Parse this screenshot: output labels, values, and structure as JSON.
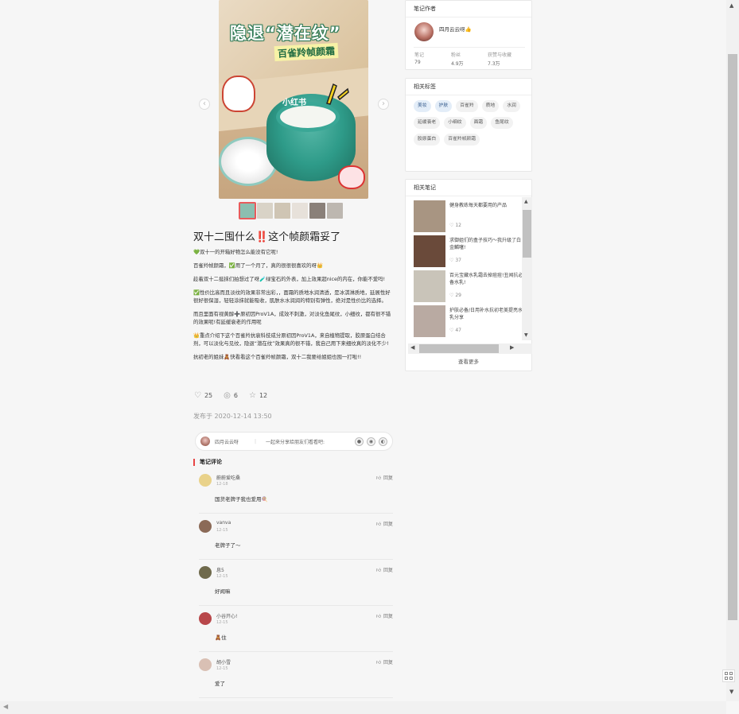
{
  "note": {
    "cover": {
      "title_text": "隐退“潜在纹”",
      "subtitle_text": "百雀羚帧颜霜",
      "watermark": "小红书"
    },
    "thumb_colors": [
      "#8bbfb0",
      "#d9d3c7",
      "#cfc5b4",
      "#e7e1da",
      "#8a8079",
      "#bdb7b0"
    ],
    "title": "双十二囤什么‼️这个帧颜霜妥了",
    "body": [
      "💚双十一的开箱好物怎么能没有它呢!",
      "百雀羚帧颜霜，✅用了一个月了，真的很很很喜欢的呀👑",
      "趁着双十二挺抹们拍想过了呀🧪绿宝石的外表，加上效果超nice的内在，你能不爱吗!",
      "✅性价比高而且淡纹的效果非常出彩，，面霜的质地水润清透，是冰淇淋质地，延展性好很好很保湿，轻轻涂抹就能吸收，肌肤水水润润的特别有弹性，绝对是性价比的选择。",
      "而且里面有视黄醇➕原初因ProV1A，成效不刺激，对淡化鱼尾纹，小细纹，都有很不错的效果呢!有延缓衰老的作用呢",
      "👑重点介绍下这个百雀羚抗衰科技成分原初因ProV1A，来自植物提取，胶原蛋白结合剂，可以淡化与见纹，隐退“潜在纹”效果真的很不错，我自己用下来细纹真的淡化不少!",
      "抗初老的姐妹🧸快看看这个百雀羚帧颜霜，双十二我要给姐姐也囤一打啦!!"
    ],
    "likes": "25",
    "comments": "6",
    "collects": "12",
    "date": "发布于 2020-12-14 13:50"
  },
  "sharebar": {
    "name": "四月云云呀",
    "separator": "|",
    "hint": "一起来分享给朋友们看看吧:"
  },
  "comments_header": "笔记评论",
  "comment_list": [
    {
      "name": "蔚蔚爱吃桑",
      "time": "12-18",
      "text": "国货老牌子我也爱用🍭",
      "reply": "回复",
      "avatar": "#e9d28a"
    },
    {
      "name": "vanva",
      "time": "12-15",
      "text": "老牌子了～",
      "reply": "回复",
      "avatar": "#8b6a57"
    },
    {
      "name": "息5",
      "time": "12-15",
      "text": "好闻嘛",
      "reply": "回复",
      "avatar": "#6f6a4c"
    },
    {
      "name": "小谷开心!",
      "time": "12-15",
      "text": "🧸住",
      "reply": "回复",
      "avatar": "#b8474a"
    },
    {
      "name": "胡小雪",
      "time": "12-15",
      "text": "爱了",
      "reply": "回复",
      "avatar": "#d9c0b4"
    }
  ],
  "author_card": {
    "header": "笔记作者",
    "name": "四月云云呀👍",
    "stats": [
      {
        "label": "笔记",
        "value": "79"
      },
      {
        "label": "粉丝",
        "value": "4.9万"
      },
      {
        "label": "获赞与收藏",
        "value": "7.3万"
      }
    ]
  },
  "tags_card": {
    "header": "相关标签",
    "tags": [
      {
        "label": "美妆",
        "hi": true
      },
      {
        "label": "护肤",
        "hi": true
      },
      {
        "label": "百雀羚",
        "hi": false
      },
      {
        "label": "质地",
        "hi": false
      },
      {
        "label": "水润",
        "hi": false
      },
      {
        "label": "延缓衰老",
        "hi": false
      },
      {
        "label": "小细纹",
        "hi": false
      },
      {
        "label": "面霜",
        "hi": false
      },
      {
        "label": "鱼尾纹",
        "hi": false
      },
      {
        "label": "胶原蛋白",
        "hi": false
      },
      {
        "label": "百雀羚帧颜霜",
        "hi": false
      }
    ]
  },
  "related_card": {
    "header": "相关笔记",
    "items": [
      {
        "text": "健身教练每天都要用的产品",
        "likes": "12",
        "img": "#a89582"
      },
      {
        "text": "求御姐们的盒子技巧～我升级了白金麟噻!",
        "likes": "37",
        "img": "#6a4a3a"
      },
      {
        "text": "百元宝藏水乳霜去掉痘痘!丑闻抗必备水乳!",
        "likes": "29",
        "img": "#c9c4b9"
      },
      {
        "text": "护肤必备/日用补水抗初老美提亮水乳分享",
        "likes": "47",
        "img": "#b9aaa2"
      }
    ],
    "see_more": "查看更多"
  }
}
